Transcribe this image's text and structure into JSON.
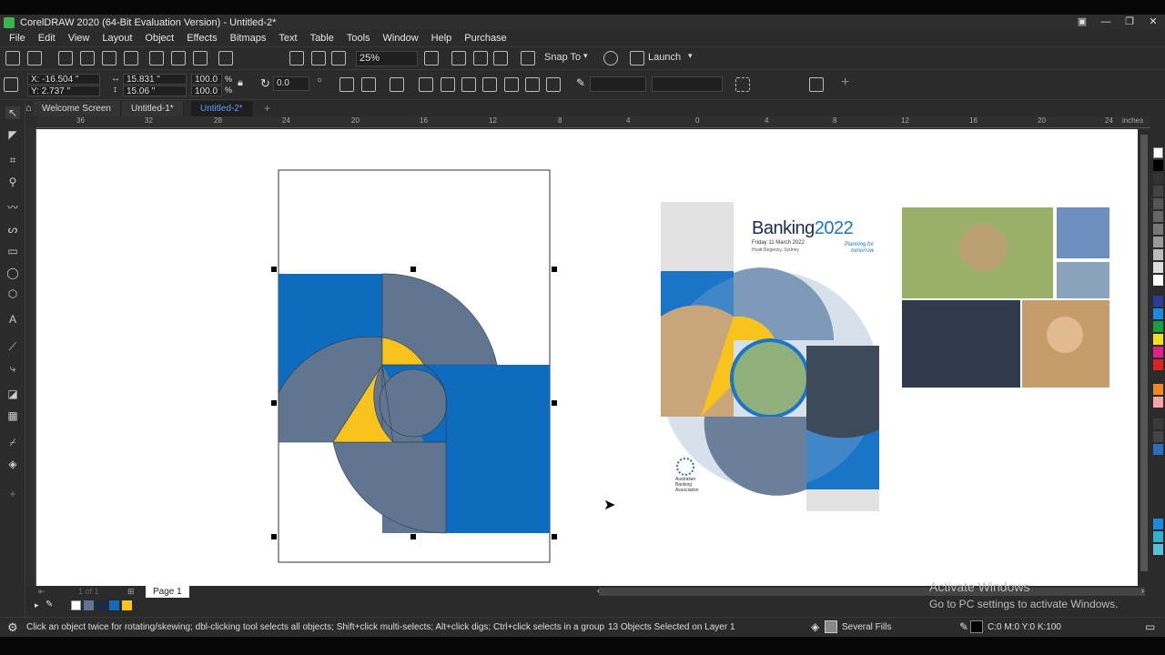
{
  "window": {
    "title": "CorelDRAW 2020 (64-Bit Evaluation Version) - Untitled-2*"
  },
  "menu": [
    "File",
    "Edit",
    "View",
    "Layout",
    "Object",
    "Effects",
    "Bitmaps",
    "Text",
    "Table",
    "Tools",
    "Window",
    "Help",
    "Purchase"
  ],
  "toolbar": {
    "zoom": "25%",
    "snap_to": "Snap To",
    "launch": "Launch"
  },
  "properties": {
    "x": "X: -16.504 \"",
    "y": "Y: 2.737 \"",
    "width": "15.831 \"",
    "height": "15.06 \"",
    "scale_w": "100.0",
    "scale_h": "100.0",
    "pct": "%",
    "angle": "0.0"
  },
  "tabs": [
    "Welcome Screen",
    "Untitled-1*",
    "Untitled-2*"
  ],
  "ruler": {
    "ticks": [
      "36",
      "32",
      "28",
      "24",
      "20",
      "16",
      "12",
      "8",
      "4",
      "0",
      "4",
      "8",
      "12",
      "16",
      "20",
      "24"
    ],
    "unit": "inches"
  },
  "design": {
    "title_prefix": "Banking",
    "title_suffix": "2022",
    "date": "Friday 11 March 2022",
    "venue": "Hyatt Regency, Sydney",
    "tagline": "Planning for tomorrow",
    "org": "Australian Banking Association"
  },
  "page": {
    "label": "Page 1",
    "counter": "1 of 1"
  },
  "status": {
    "hint": "Click an object twice for rotating/skewing; dbl-clicking tool selects all objects; Shift+click multi-selects; Alt+click digs; Ctrl+click selects in a group",
    "selection": "13 Objects Selected on Layer 1",
    "fill": "Several Fills",
    "color": "C:0 M:0 Y:0 K:100"
  },
  "watermark": {
    "line1": "Activate Windows",
    "line2": "Go to PC settings to activate Windows."
  },
  "colors": {
    "blue": "#0f6bbd",
    "slate": "#5f7590",
    "yellow": "#f7c31c"
  }
}
